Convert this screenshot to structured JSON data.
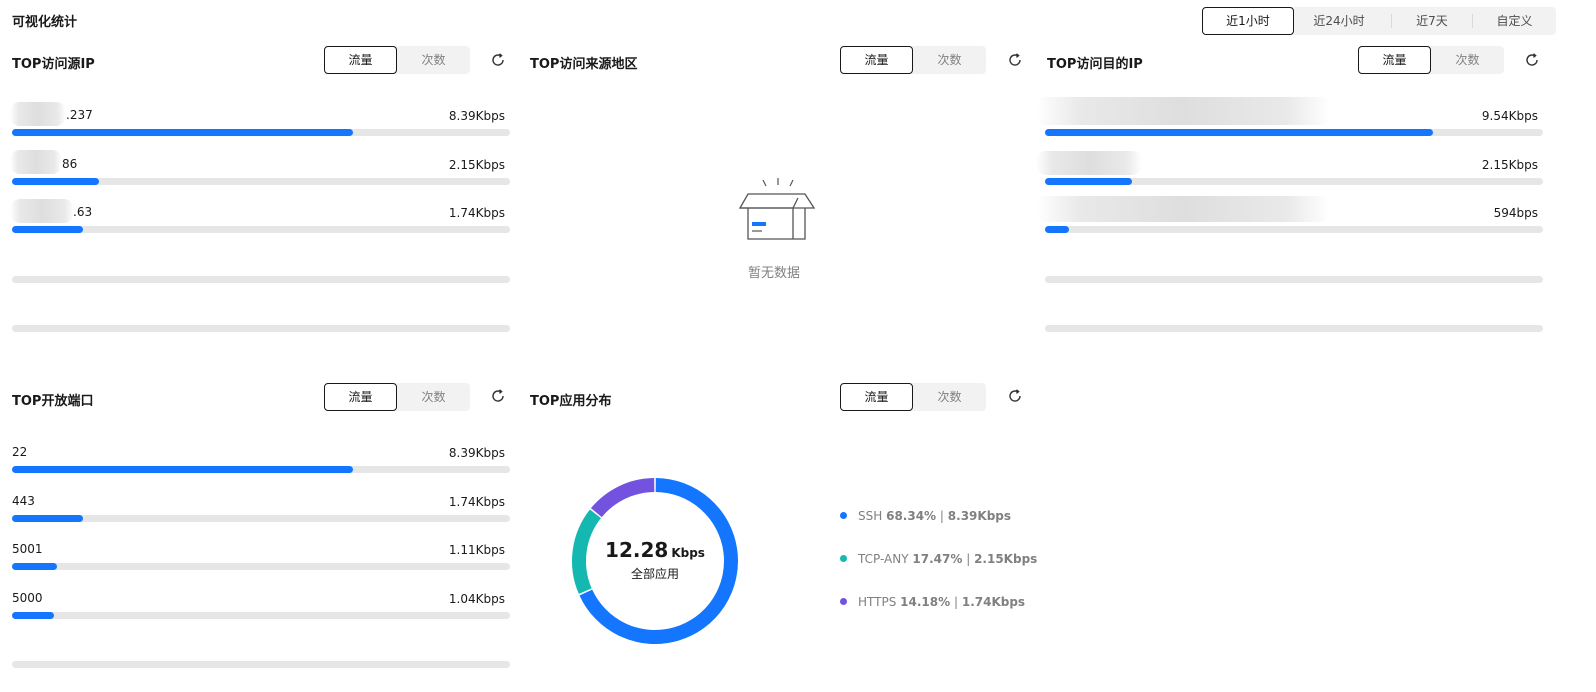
{
  "page": {
    "title": "可视化统计"
  },
  "time_range": {
    "options": [
      "近1小时",
      "近24小时",
      "近7天",
      "自定义"
    ],
    "selected": "近1小时"
  },
  "toggle": {
    "active": "流量",
    "inactive": "次数"
  },
  "panels": {
    "src_ip": {
      "title": "TOP访问源IP",
      "rows": [
        {
          "label": ".237",
          "value": "8.39Kbps",
          "ratio": 0.685
        },
        {
          "label": "86",
          "value": "2.15Kbps",
          "ratio": 0.175
        },
        {
          "label": ".63",
          "value": "1.74Kbps",
          "ratio": 0.143
        }
      ]
    },
    "region": {
      "title": "TOP访问来源地区",
      "empty_text": "暂无数据"
    },
    "dst_ip": {
      "title": "TOP访问目的IP",
      "rows": [
        {
          "label": "",
          "value": "9.54Kbps",
          "ratio": 0.78
        },
        {
          "label": "",
          "value": "2.15Kbps",
          "ratio": 0.175
        },
        {
          "label": "",
          "value": "594bps",
          "ratio": 0.049
        }
      ]
    },
    "ports": {
      "title": "TOP开放端口",
      "rows": [
        {
          "label": "22",
          "value": "8.39Kbps",
          "ratio": 0.685
        },
        {
          "label": "443",
          "value": "1.74Kbps",
          "ratio": 0.143
        },
        {
          "label": "5001",
          "value": "1.11Kbps",
          "ratio": 0.091
        },
        {
          "label": "5000",
          "value": "1.04Kbps",
          "ratio": 0.085
        }
      ]
    },
    "apps": {
      "title": "TOP应用分布",
      "total_value": "12.28",
      "total_unit": "Kbps",
      "total_label": "全部应用",
      "legend": [
        {
          "name": "SSH",
          "percent": "68.34%",
          "sep": "|",
          "rate": "8.39Kbps",
          "color": "#1476ff"
        },
        {
          "name": "TCP-ANY",
          "percent": "17.47%",
          "sep": "|",
          "rate": "2.15Kbps",
          "color": "#14b8b0"
        },
        {
          "name": "HTTPS",
          "percent": "14.18%",
          "sep": "|",
          "rate": "1.74Kbps",
          "color": "#7352e0"
        }
      ]
    }
  },
  "chart_data": {
    "type": "pie",
    "categories": [
      "SSH",
      "TCP-ANY",
      "HTTPS"
    ],
    "values": [
      68.34,
      17.47,
      14.18
    ],
    "title": "TOP应用分布"
  }
}
